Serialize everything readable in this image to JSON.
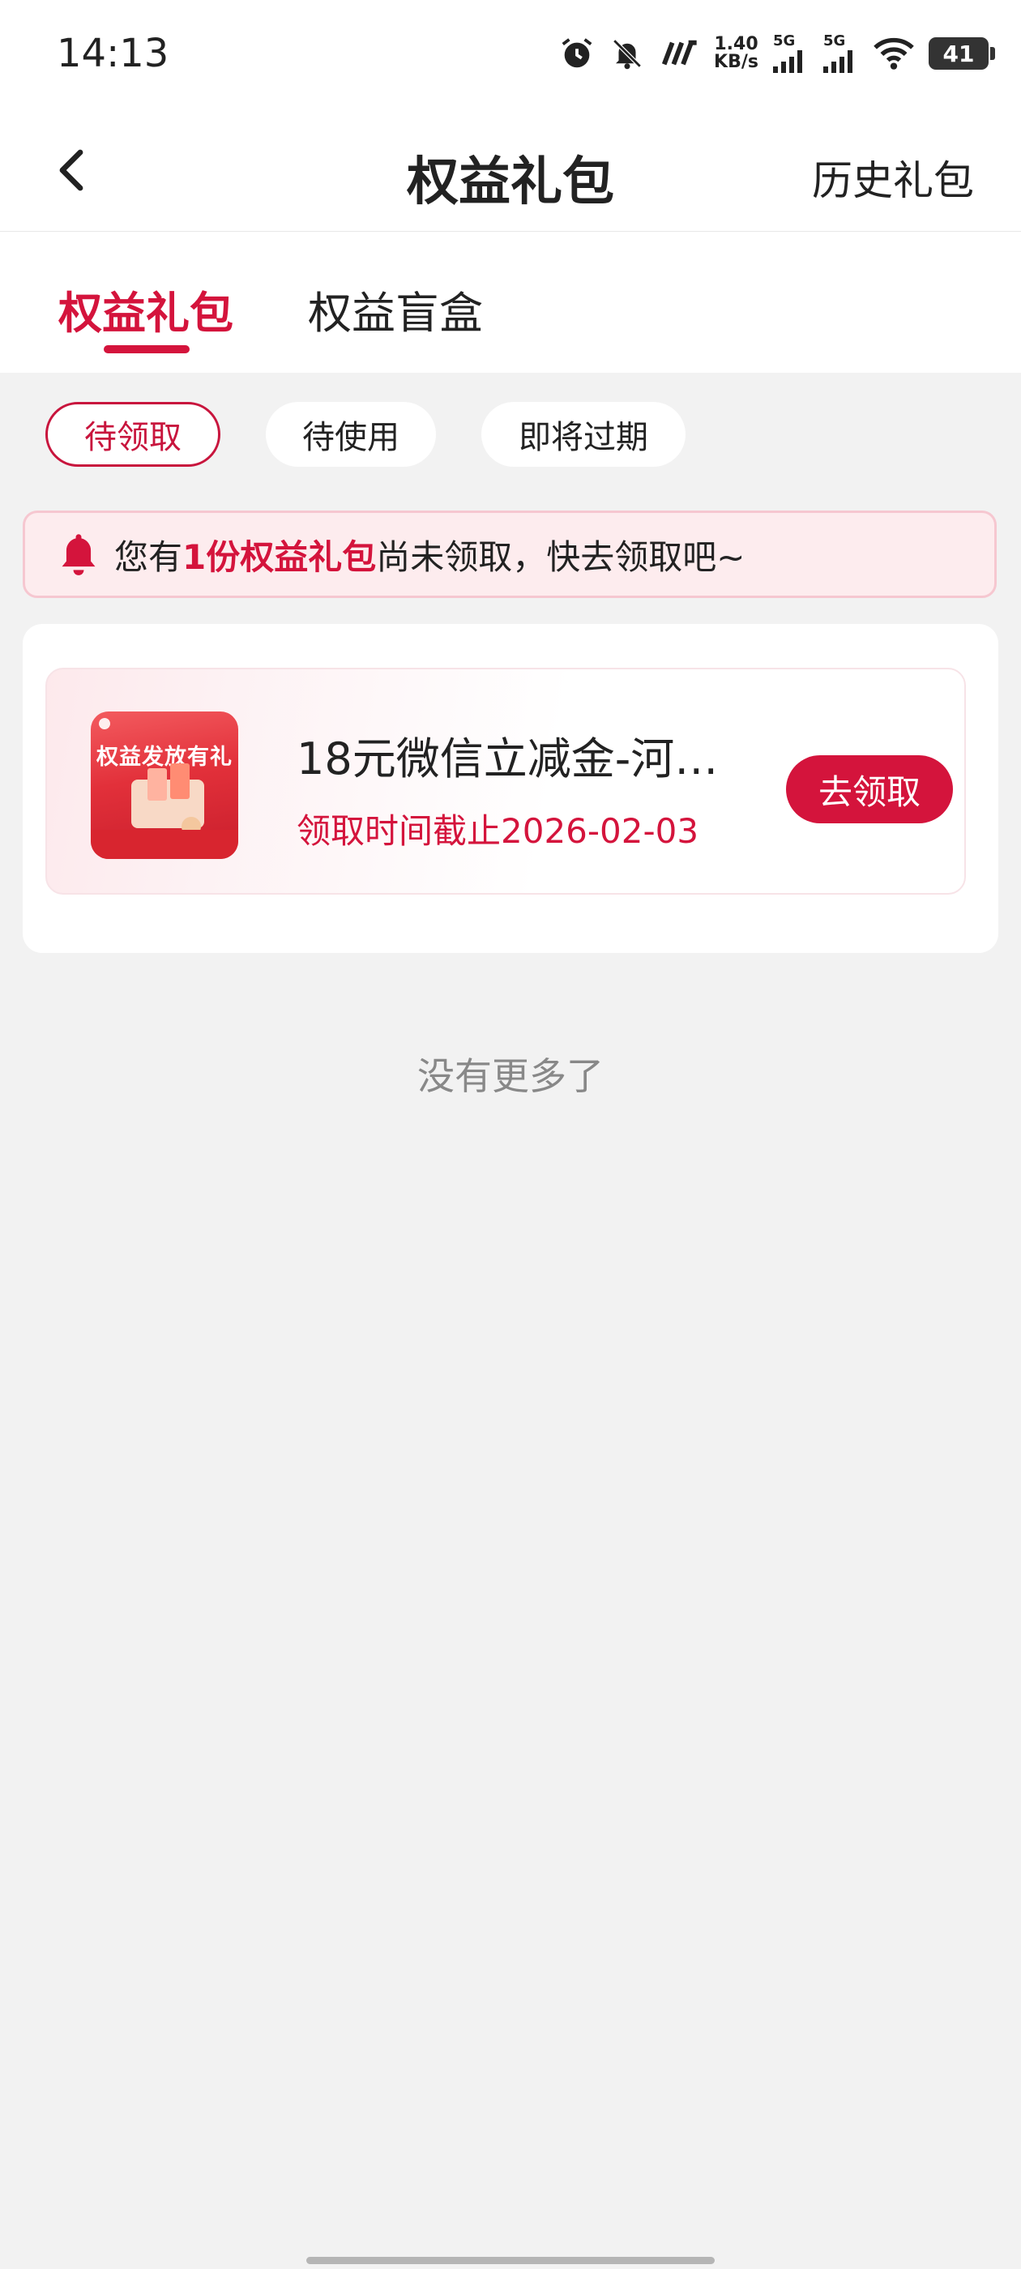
{
  "status_bar": {
    "time": "14:13",
    "net_speed_value": "1.40",
    "net_speed_unit": "KB/s",
    "sim1": "5G",
    "sim2": "5G",
    "battery": "41",
    "icons": [
      "alarm-icon",
      "mute-bell-icon",
      "nfc-icon",
      "signal-icon",
      "signal-icon",
      "wifi-icon",
      "battery-icon"
    ]
  },
  "header": {
    "title": "权益礼包",
    "back_icon": "chevron-left-icon",
    "history_label": "历史礼包"
  },
  "tabs": [
    {
      "label": "权益礼包",
      "active": true
    },
    {
      "label": "权益盲盒",
      "active": false
    }
  ],
  "filters": [
    {
      "label": "待领取",
      "active": true
    },
    {
      "label": "待使用",
      "active": false
    },
    {
      "label": "即将过期",
      "active": false
    }
  ],
  "notice": {
    "icon": "bell-icon",
    "prefix": "您有",
    "highlight": "1份权益礼包",
    "suffix": "尚未领取，快去领取吧~"
  },
  "gifts": [
    {
      "thumbnail_text": "权益发放有礼",
      "title": "18元微信立减金-河…",
      "deadline": "领取时间截止2026-02-03",
      "button_label": "去领取"
    }
  ],
  "footer_text": "没有更多了",
  "colors": {
    "accent": "#d4143c",
    "background": "#f2f2f2",
    "notice_bg": "#fdecee"
  }
}
